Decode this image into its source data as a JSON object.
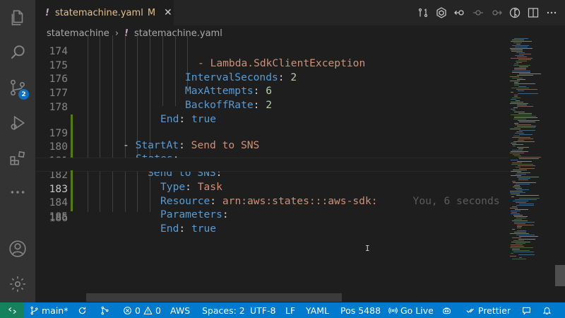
{
  "tab": {
    "title": "statemachine.yaml",
    "modified_flag": "M",
    "file_icon": "!"
  },
  "breadcrumb": {
    "folder": "statemachine",
    "file": "statemachine.yaml",
    "file_icon": "!"
  },
  "activity_bar": {
    "scm_badge": "2"
  },
  "editor": {
    "lines": [
      {
        "number": "174",
        "text": "- Lambda.SdkClientException"
      },
      {
        "number": "175",
        "key": "IntervalSeconds",
        "value": "2"
      },
      {
        "number": "176",
        "key": "MaxAttempts",
        "value": "6"
      },
      {
        "number": "177",
        "key": "BackoffRate",
        "value": "2"
      },
      {
        "number": "178",
        "key": "End",
        "value": "true"
      },
      {
        "number": "179",
        "dash": "- ",
        "key": "StartAt",
        "value": "Send to SNS"
      },
      {
        "number": "180",
        "key": "States",
        "value": ""
      },
      {
        "number": "181",
        "key": "Send to SNS",
        "value": ""
      },
      {
        "number": "182",
        "key": "Type",
        "value": "Task"
      },
      {
        "number": "183",
        "key": "Resource",
        "value": "arn:aws:states:::aws-sdk:",
        "blame": "You, 6 seconds"
      },
      {
        "number": "184",
        "key": "Parameters",
        "value": ""
      },
      {
        "number": "185",
        "key": "End",
        "value": "true"
      },
      {
        "number": "186"
      }
    ]
  },
  "status_bar": {
    "branch": "main*",
    "errors": "0",
    "warnings": "0",
    "aws": "AWS",
    "spaces": "Spaces: 2",
    "encoding": "UTF-8",
    "eol": "LF",
    "language": "YAML",
    "position": "Pos 5488",
    "go_live": "Go Live",
    "prettier": "Prettier"
  },
  "colors": {
    "status_bar": "#007acc",
    "remote": "#16825d",
    "key": "#569cd6",
    "string": "#ce9178",
    "number": "#b5cea8",
    "gutter_added": "#587c0c"
  }
}
